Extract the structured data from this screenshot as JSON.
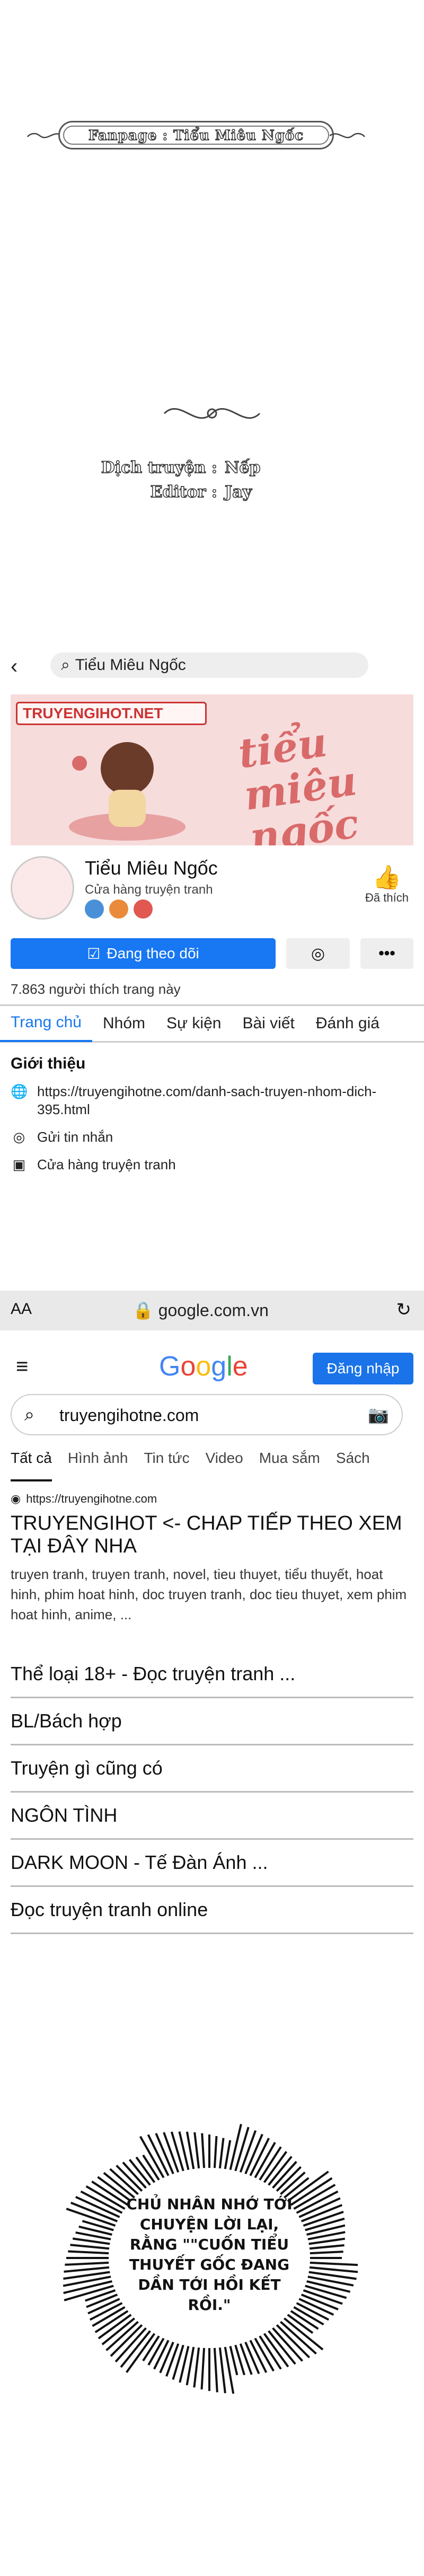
{
  "header": {
    "fanpage": "Fanpage : Tiểu Miêu Ngốc"
  },
  "credits": [
    {
      "label": "Dịch truyện :",
      "value": "Nếp"
    },
    {
      "label": "Editor :",
      "value": "Jay"
    }
  ],
  "facebook": {
    "search_query": "Tiểu Miêu Ngốc",
    "cover_tag": "TRUYENGIHOT.NET",
    "cover_art": "tiểu miêu ngốc",
    "page_name": "Tiểu Miêu Ngốc",
    "page_type": "Cửa hàng truyện tranh",
    "liked_label": "Đã thích",
    "follow_label": "Đang theo dõi",
    "likes_text": "7.863 người thích trang này",
    "tabs": [
      "Trang chủ",
      "Nhóm",
      "Sự kiện",
      "Bài viết",
      "Đánh giá"
    ],
    "intro_title": "Giới thiệu",
    "intro_link": "https://truyengihotne.com/danh-sach-truyen-nhom-dich-395.html",
    "intro_message": "Gửi tin nhắn",
    "intro_shop": "Cửa hàng truyện tranh"
  },
  "browser": {
    "aa": "AA",
    "url": "google.com.vn"
  },
  "google": {
    "logo": [
      "G",
      "o",
      "o",
      "g",
      "l",
      "e"
    ],
    "signin": "Đăng nhập",
    "query": "truyengihotne.com",
    "tabs": [
      "Tất cả",
      "Hình ảnh",
      "Tin tức",
      "Video",
      "Mua sắm",
      "Sách"
    ],
    "result_url": "https://truyengihotne.com",
    "result_title": "TRUYENGIHOT <- CHAP TIẾP THEO XEM TẠI ĐÂY NHA",
    "result_snippet": "truyen tranh, truyen tranh, novel, tieu thuyet, tiểu thuyết, hoat hinh, phim hoat hinh, doc truyen tranh, doc tieu thuyet, xem phim hoat hinh, anime, ...",
    "sitelinks": [
      "Thể loại 18+ - Đọc truyện tranh ...",
      "BL/Bách hợp",
      "Truyện gì cũng có",
      "NGÔN TÌNH",
      "DARK MOON - Tế Đàn Ánh ...",
      "Đọc truyện tranh online"
    ]
  },
  "bubble": {
    "text": "CHỦ NHÂN NHỚ TỚI CHUYỆN LỜI LẠI, RẰNG \"\"CUỐN TIỂU THUYẾT GỐC ĐANG DẦN TỚI HỒI KẾT RỒI.\""
  }
}
